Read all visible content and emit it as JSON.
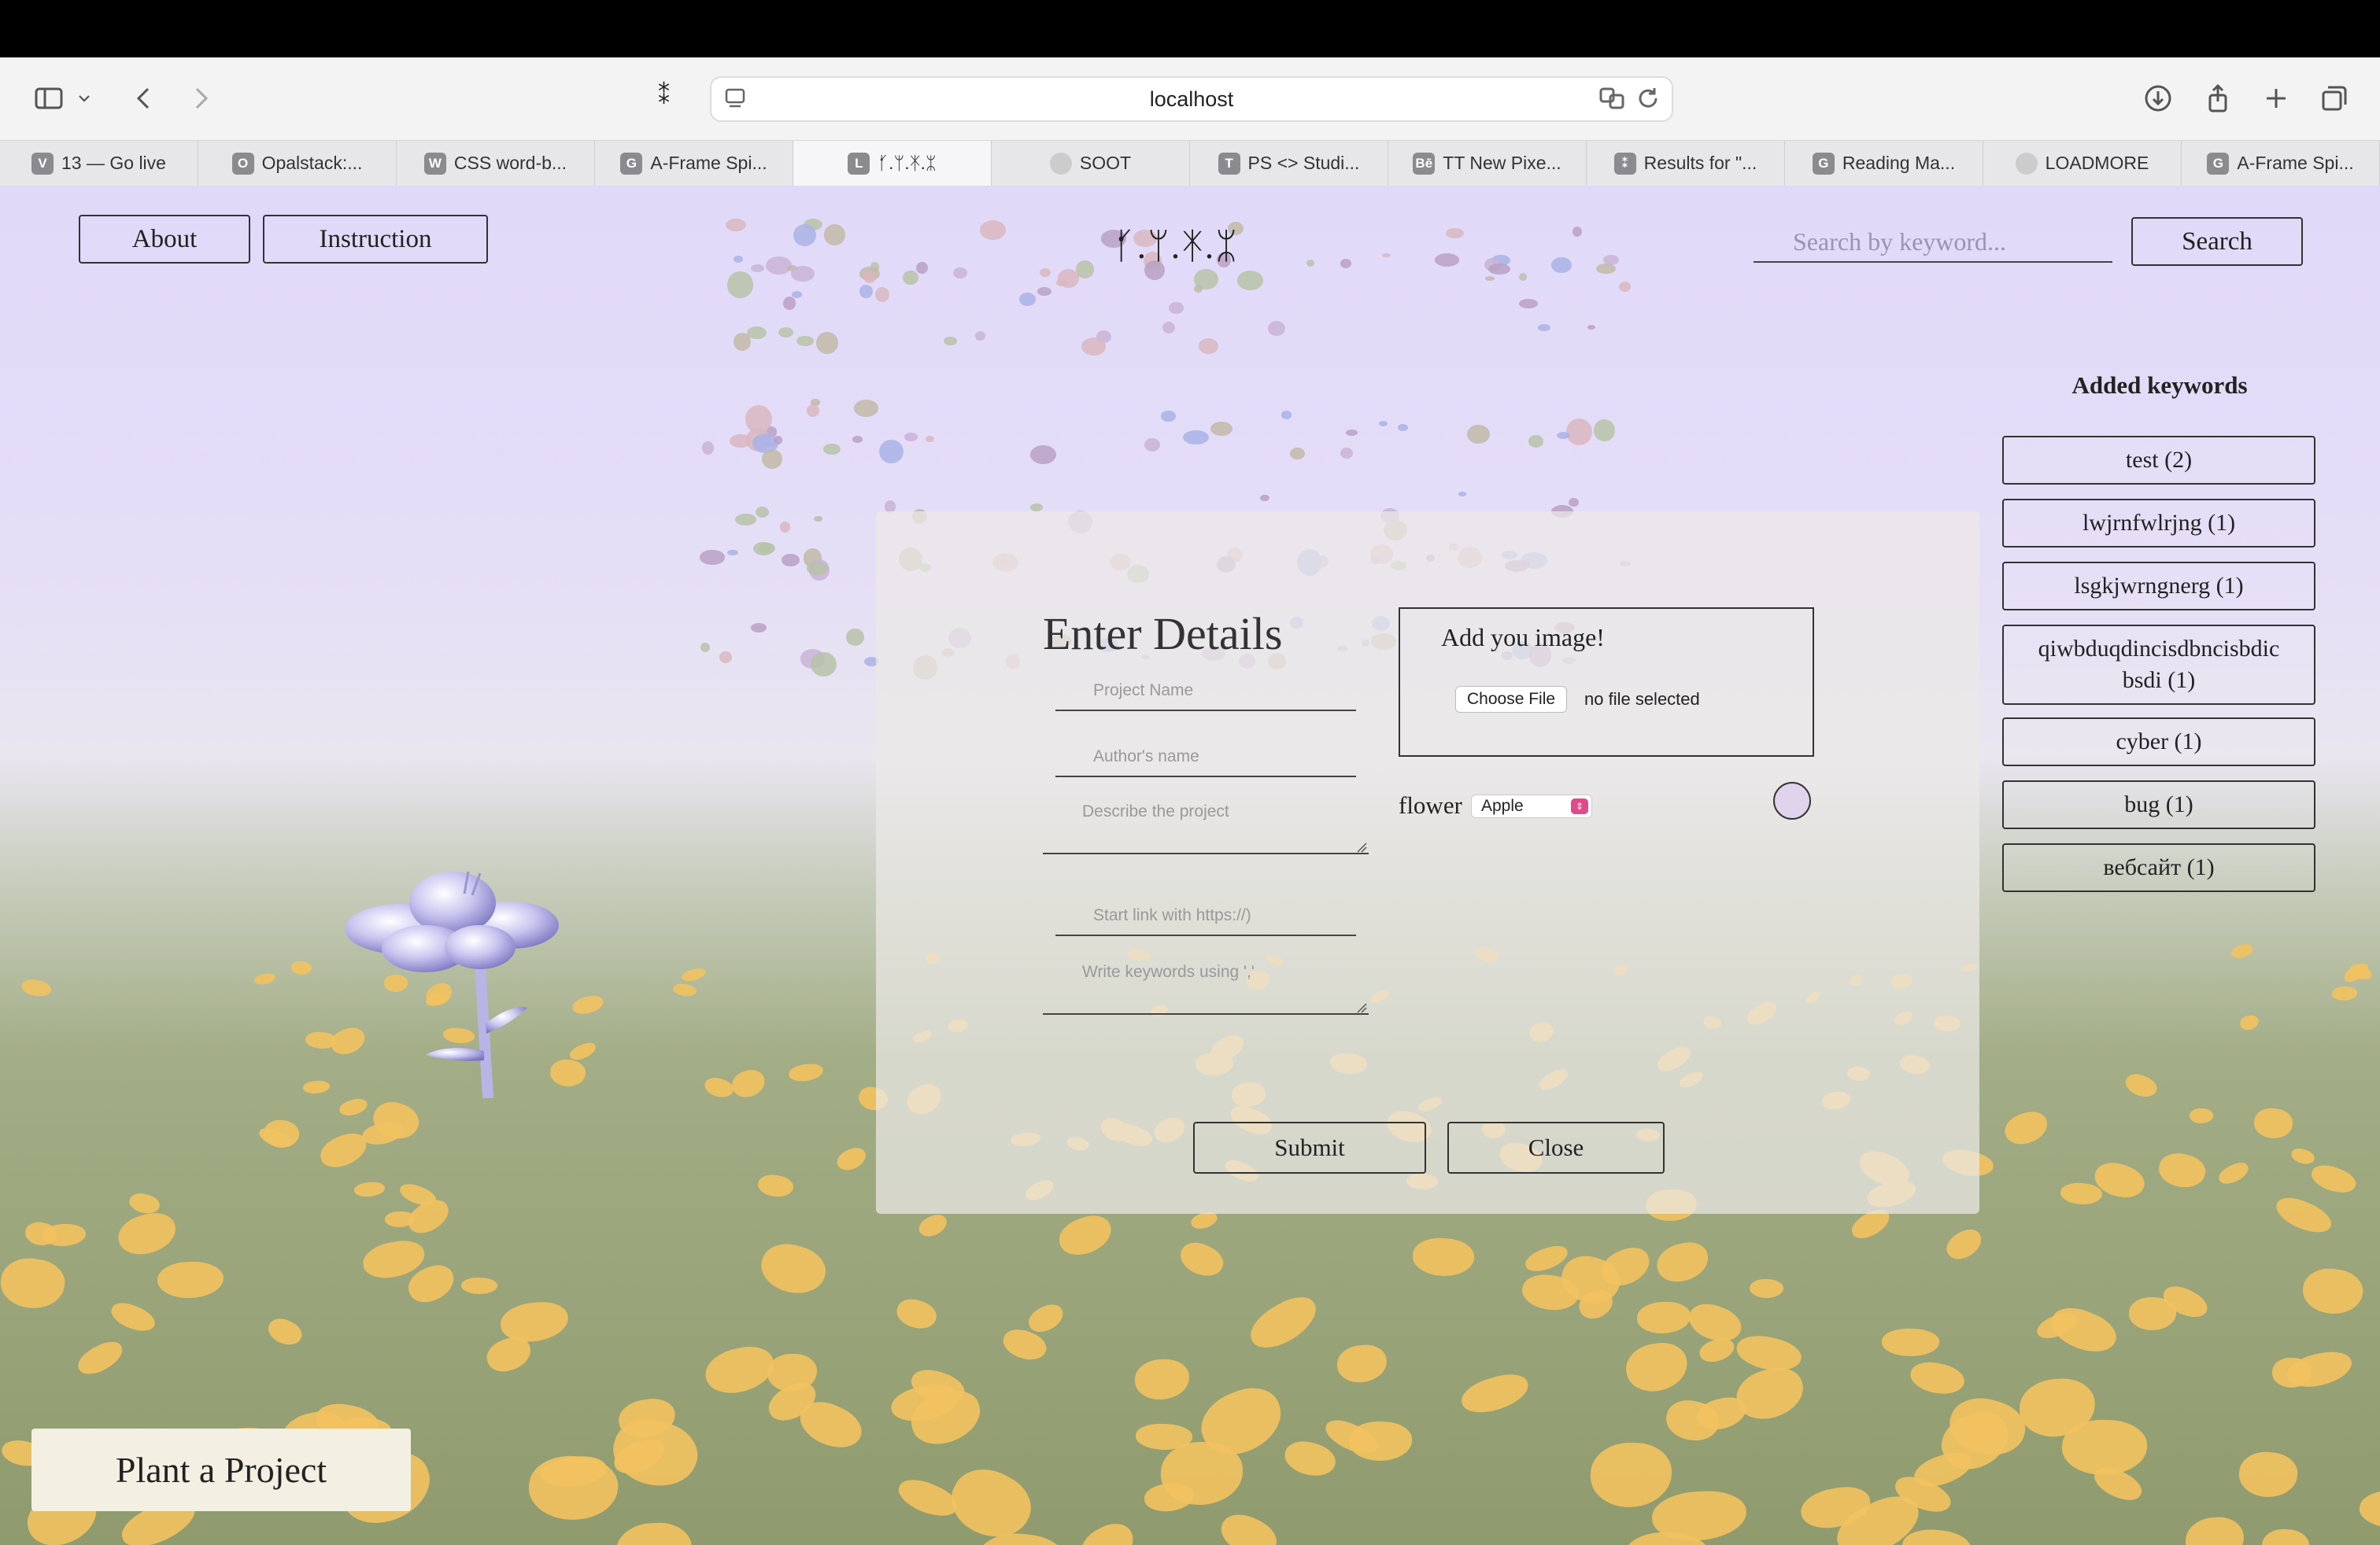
{
  "browser": {
    "url": "localhost",
    "tabs": [
      {
        "label": "13 — Go live",
        "favicon": "V"
      },
      {
        "label": "Opalstack:...",
        "favicon": "O"
      },
      {
        "label": "CSS word-b...",
        "favicon": "W"
      },
      {
        "label": "A-Frame Spi...",
        "favicon": "G"
      },
      {
        "label": "ᚶ.ᛘ.ᛡ.ᛯ",
        "favicon": "L"
      },
      {
        "label": "SOOT",
        "favicon": ""
      },
      {
        "label": "PS <> Studi...",
        "favicon": "T"
      },
      {
        "label": "TT New Pixe...",
        "favicon": "Bē"
      },
      {
        "label": "Results for \"...",
        "favicon": "⁑"
      },
      {
        "label": "Reading Ma...",
        "favicon": "G"
      },
      {
        "label": "LOADMORE",
        "favicon": ""
      },
      {
        "label": "A-Frame Spi...",
        "favicon": "G"
      }
    ],
    "active_tab_index": 4
  },
  "nav": {
    "about_label": "About",
    "instruction_label": "Instruction",
    "logo_text": "ᚶ.ᛘ.ᛡ.ᛯ"
  },
  "search": {
    "placeholder": "Search by keyword...",
    "button_label": "Search"
  },
  "keywords": {
    "title": "Added keywords",
    "items": [
      "test (2)",
      "lwjrnfwlrjng (1)",
      "lsgkjwrngnerg (1)",
      "qiwbduqdincisdbncisbdic bsdi (1)",
      "cyber (1)",
      "bug (1)",
      "вебсайт (1)"
    ]
  },
  "modal": {
    "title": "Enter Details",
    "project_name_placeholder": "Project Name",
    "author_placeholder": "Author's name",
    "describe_placeholder": "Describe the project",
    "link_placeholder": "Start link with https://)",
    "keywords_placeholder": "Write keywords using ','",
    "image_box_title": "Add you image!",
    "choose_file_label": "Choose File",
    "no_file_text": "no file selected",
    "flower_label": "flower",
    "flower_selected": "Apple",
    "submit_label": "Submit",
    "close_label": "Close"
  },
  "plant_button_label": "Plant a Project",
  "colors": {
    "sky": "#e0d9f8",
    "grass": "#8f9b6e",
    "blob": "#f2c25f",
    "select_accent": "#e04a8b"
  }
}
